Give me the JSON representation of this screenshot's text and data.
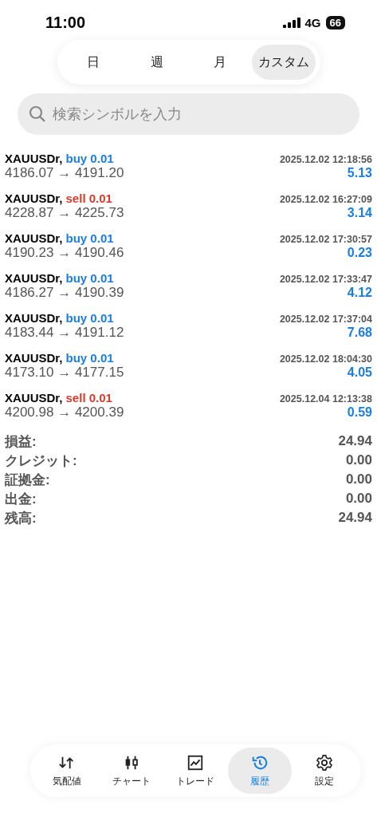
{
  "status_bar": {
    "time": "11:00",
    "network": "4G",
    "battery": "66"
  },
  "periods": [
    {
      "label": "日",
      "selected": false
    },
    {
      "label": "週",
      "selected": false
    },
    {
      "label": "月",
      "selected": false
    },
    {
      "label": "カスタム",
      "selected": true
    }
  ],
  "search": {
    "placeholder": "検索シンボルを入力"
  },
  "trades": [
    {
      "symbol": "XAUUSDr,",
      "kind": "buy",
      "order": "buy 0.01",
      "time": "2025.12.02 12:18:56",
      "prices": "4186.07 → 4191.20",
      "profit": "5.13"
    },
    {
      "symbol": "XAUUSDr,",
      "kind": "sell",
      "order": "sell 0.01",
      "time": "2025.12.02 16:27:09",
      "prices": "4228.87 → 4225.73",
      "profit": "3.14"
    },
    {
      "symbol": "XAUUSDr,",
      "kind": "buy",
      "order": "buy 0.01",
      "time": "2025.12.02 17:30:57",
      "prices": "4190.23 → 4190.46",
      "profit": "0.23"
    },
    {
      "symbol": "XAUUSDr,",
      "kind": "buy",
      "order": "buy 0.01",
      "time": "2025.12.02 17:33:47",
      "prices": "4186.27 → 4190.39",
      "profit": "4.12"
    },
    {
      "symbol": "XAUUSDr,",
      "kind": "buy",
      "order": "buy 0.01",
      "time": "2025.12.02 17:37:04",
      "prices": "4183.44 → 4191.12",
      "profit": "7.68"
    },
    {
      "symbol": "XAUUSDr,",
      "kind": "buy",
      "order": "buy 0.01",
      "time": "2025.12.02 18:04:30",
      "prices": "4173.10 → 4177.15",
      "profit": "4.05"
    },
    {
      "symbol": "XAUUSDr,",
      "kind": "sell",
      "order": "sell 0.01",
      "time": "2025.12.04 12:13:38",
      "prices": "4200.98 → 4200.39",
      "profit": "0.59"
    }
  ],
  "summary": [
    {
      "label": "損益:",
      "value": "24.94"
    },
    {
      "label": "クレジット:",
      "value": "0.00"
    },
    {
      "label": "証拠金:",
      "value": "0.00"
    },
    {
      "label": "出金:",
      "value": "0.00"
    },
    {
      "label": "残高:",
      "value": "24.94"
    }
  ],
  "tab_bar": [
    {
      "kind": "quotes",
      "label": "気配値",
      "selected": false
    },
    {
      "kind": "chart",
      "label": "チャート",
      "selected": false
    },
    {
      "kind": "trade",
      "label": "トレード",
      "selected": false
    },
    {
      "kind": "history",
      "label": "履歴",
      "selected": true
    },
    {
      "kind": "settings",
      "label": "設定",
      "selected": false
    }
  ]
}
